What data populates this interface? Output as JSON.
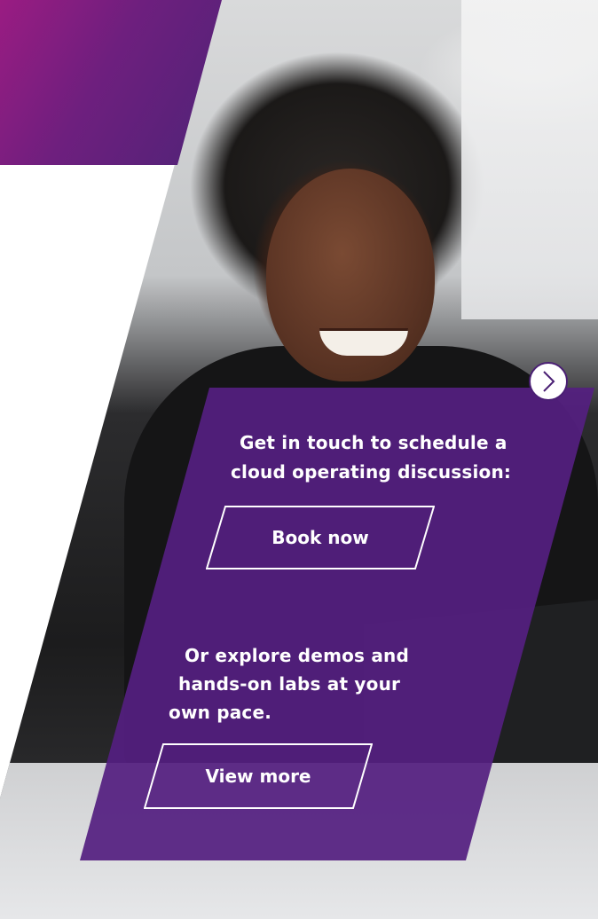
{
  "promo": {
    "intro_line_1": "Get in touch to schedule a",
    "intro_line_2": "cloud operating discussion:",
    "book_label": "Book now",
    "explore_line_1": "Or explore demos and",
    "explore_line_2": "hands-on labs at your",
    "explore_line_3": "own pace.",
    "view_label": "View more",
    "next_icon": "chevron-right-icon"
  },
  "colors": {
    "panel": "#541f80",
    "band_start": "#9a1c82",
    "band_end": "#4f2377",
    "text": "#ffffff"
  }
}
